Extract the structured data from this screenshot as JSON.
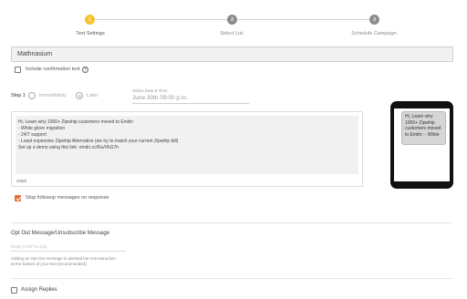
{
  "stepper": {
    "steps": [
      {
        "number": "1",
        "label": "Text Settings",
        "active": true
      },
      {
        "number": "2",
        "label": "Select List",
        "active": false
      },
      {
        "number": "3",
        "label": "Schedule Campaign",
        "active": false
      }
    ],
    "colors": {
      "active": "#f5c12e",
      "inactive": "#8c8c8c"
    }
  },
  "campaign_name": "Mathnasium",
  "include_confirmation": {
    "label": "Include confirmation text",
    "checked": false,
    "help_icon": "?"
  },
  "step1": {
    "label": "Step 1",
    "immediately_label": "Immediately",
    "later_label": "Later",
    "selected": "Later"
  },
  "date": {
    "label": "Select Date & Time",
    "value": "June 30th 09:00 p.m."
  },
  "message": {
    "lines": [
      "Hi, Learn why 1000+ Zipwhip customers moved to Emitrr:",
      "- White glove migration",
      "- 24/7 support",
      "- Least expensive Zipwhip Alternative (we try to match your current Zipwhip bill)",
      "Set up a demo using this link: emitrr.cc/Ru/VkG7h"
    ],
    "count": "229/2"
  },
  "stop_followup": {
    "label": "Stop followup messages on response",
    "checked": true
  },
  "phone_preview": {
    "text": "Hi, Learn why 1000+ Zipwhip customers moved to Emitrr: - White"
  },
  "opt_out": {
    "title": "Opt Out Message/Unsubscribe Message",
    "placeholder": "Reply STOP to stop",
    "hint_line1": "Adding an Opt Out message is advised but not instruction",
    "hint_line2": "at the bottom of your text (recommended)"
  },
  "assign_replies": {
    "label": "Assign Replies",
    "checked": false
  },
  "accent_color": "#e8703a"
}
